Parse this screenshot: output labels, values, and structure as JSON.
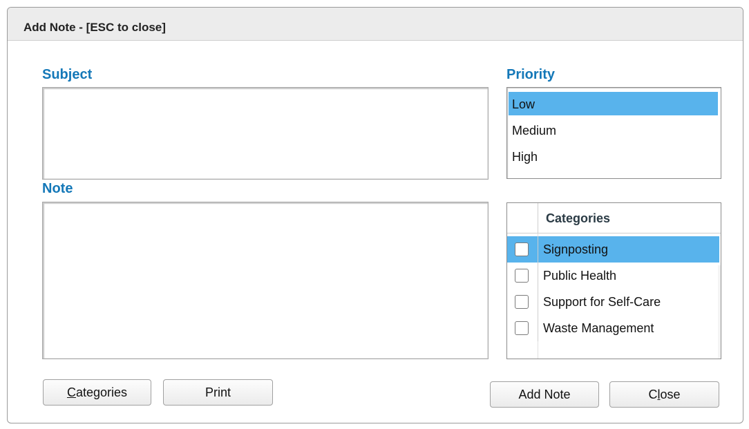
{
  "dialog": {
    "title": "Add Note - [ESC to close]"
  },
  "subject": {
    "label": "Subject",
    "value": ""
  },
  "note": {
    "label": "Note",
    "value": ""
  },
  "priority": {
    "label": "Priority",
    "options": [
      "Low",
      "Medium",
      "High"
    ],
    "selected": "Low"
  },
  "categories": {
    "header": "Categories",
    "items": [
      {
        "label": "Signposting",
        "checked": false,
        "selected": true
      },
      {
        "label": "Public Health",
        "checked": false,
        "selected": false
      },
      {
        "label": "Support for Self-Care",
        "checked": false,
        "selected": false
      },
      {
        "label": "Waste Management",
        "checked": false,
        "selected": false
      }
    ]
  },
  "buttons": {
    "categories": {
      "accel": "C",
      "rest": "ategories"
    },
    "print": "Print",
    "add_note": "Add Note",
    "close": {
      "pre": "C",
      "accel": "l",
      "rest": "ose"
    }
  },
  "colors": {
    "label_blue": "#1478b8",
    "selection_blue": "#58b3ec"
  }
}
